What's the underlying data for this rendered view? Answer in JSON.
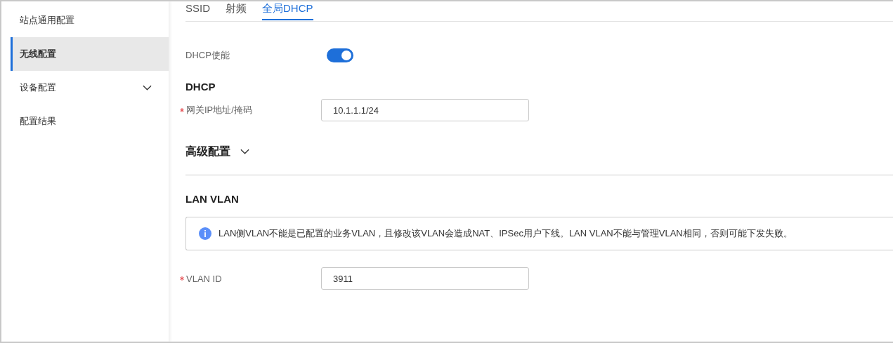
{
  "sidebar": {
    "items": [
      {
        "label": "站点通用配置",
        "selected": false
      },
      {
        "label": "无线配置",
        "selected": true
      },
      {
        "label": "设备配置",
        "selected": false,
        "expanded": false
      },
      {
        "label": "配置结果",
        "selected": false
      }
    ]
  },
  "tabs": [
    {
      "label": "SSID",
      "selected": false
    },
    {
      "label": "射频",
      "selected": false
    },
    {
      "label": "全局DHCP",
      "selected": true
    }
  ],
  "form": [
    {
      "kind": "toggle",
      "label": "DHCP使能",
      "on": true
    },
    {
      "kind": "heading",
      "text": "DHCP"
    },
    {
      "kind": "field",
      "label": "网关IP地址/掩码",
      "required": true,
      "value": "10.1.1.1/24"
    },
    {
      "kind": "collapsible",
      "text": "高级配置",
      "expanded": false
    },
    {
      "kind": "divider"
    },
    {
      "kind": "heading",
      "text": "LAN VLAN"
    },
    {
      "kind": "alert",
      "text": "LAN侧VLAN不能是已配置的业务VLAN，且修改该VLAN会造成NAT、IPSec用户下线。LAN VLAN不能与管理VLAN相同，否则可能下发失败。"
    },
    {
      "kind": "field",
      "label": "VLAN ID",
      "required": true,
      "value": "3911"
    }
  ]
}
